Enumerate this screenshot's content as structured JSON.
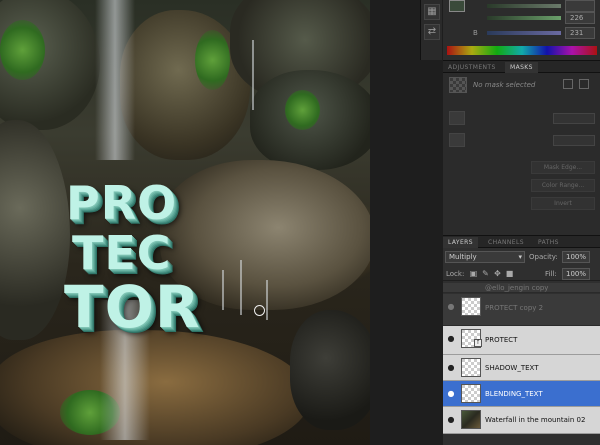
{
  "document": {
    "title_lines": [
      "PRO",
      "TEC",
      "TOR"
    ]
  },
  "color_panel": {
    "sliders": [
      {
        "label": "",
        "value": "",
        "gradient": "#2a3a2a,#6a7a6a"
      },
      {
        "label": "",
        "value": "226",
        "gradient": "#2a3a2a,#6aa06a"
      },
      {
        "label": "B",
        "value": "231",
        "gradient": "#2a3a5a,#6a6aa0"
      }
    ],
    "foreground_color": "#3a4a3a"
  },
  "masks_panel": {
    "tabs": [
      "ADJUSTMENTS",
      "MASKS"
    ],
    "active_tab": "MASKS",
    "status": "No mask selected",
    "buttons": [
      "Mask Edge...",
      "Color Range...",
      "Invert"
    ]
  },
  "layers_panel": {
    "tabs": [
      "LAYERS",
      "CHANNELS",
      "PATHS"
    ],
    "active_tab": "LAYERS",
    "blend_mode": "Multiply",
    "opacity_label": "Opacity:",
    "opacity": "100%",
    "lock_label": "Lock:",
    "fill_label": "Fill:",
    "fill": "100%",
    "layers": [
      {
        "name": "@ello_jengin copy",
        "style": "dim",
        "thumb": "transparent"
      },
      {
        "name": "PROTECT copy 2",
        "style": "dim",
        "thumb": "transparent"
      },
      {
        "name": "PROTECT",
        "style": "light",
        "thumb": "transparent",
        "fx": true
      },
      {
        "name": "SHADOW_TEXT",
        "style": "light",
        "thumb": "transparent"
      },
      {
        "name": "BLENDING_TEXT",
        "style": "selected",
        "thumb": "transparent"
      },
      {
        "name": "Waterfall  in the mountain 02",
        "style": "light",
        "thumb": "photo"
      }
    ]
  },
  "colors": {
    "selection": "#3b6fcf",
    "text_face": "#bff2e6"
  }
}
